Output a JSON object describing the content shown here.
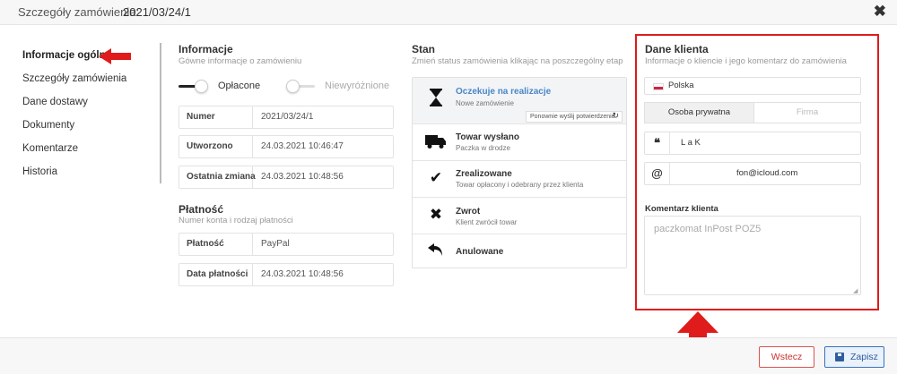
{
  "header": {
    "label": "Szczegóły zamówienia:",
    "order_id": "2021/03/24/1",
    "close_icon": "close-icon"
  },
  "nav": {
    "items": [
      {
        "label": "Informacje ogólne",
        "active": true
      },
      {
        "label": "Szczegóły zamówienia"
      },
      {
        "label": "Dane dostawy"
      },
      {
        "label": "Dokumenty"
      },
      {
        "label": "Komentarze"
      },
      {
        "label": "Historia"
      }
    ]
  },
  "info": {
    "title": "Informacje",
    "subtitle": "Gówne informacje o zamówieniu",
    "toggle_paid": {
      "label": "Opłacone",
      "on": true
    },
    "toggle_featured": {
      "label": "Niewyróżnione",
      "on": false
    },
    "fields": [
      {
        "label": "Numer",
        "value": "2021/03/24/1"
      },
      {
        "label": "Utworzono",
        "value": "24.03.2021 10:46:47"
      },
      {
        "label": "Ostatnia zmiana",
        "value": "24.03.2021 10:48:56"
      }
    ]
  },
  "payment": {
    "title": "Płatność",
    "subtitle": "Numer konta i rodzaj płatności",
    "fields": [
      {
        "label": "Płatność",
        "value": "PayPal"
      },
      {
        "label": "Data płatności",
        "value": "24.03.2021 10:48:56"
      }
    ]
  },
  "status": {
    "title": "Stan",
    "subtitle": "Zmień status zamówienia klikając na poszczególny etap",
    "resend_label": "Ponownie wyślij potwierdzenie",
    "items": [
      {
        "title": "Oczekuje na realizacje",
        "sub": "Nowe zamówienie",
        "icon": "hourglass-icon",
        "active": true
      },
      {
        "title": "Towar wysłano",
        "sub": "Paczka w drodze",
        "icon": "truck-icon"
      },
      {
        "title": "Zrealizowane",
        "sub": "Towar opłacony i odebrany przez klienta",
        "icon": "check-icon"
      },
      {
        "title": "Zwrot",
        "sub": "Klient zwrócił towar",
        "icon": "x-icon"
      },
      {
        "title": "Anulowane",
        "sub": "",
        "icon": "undo-icon"
      }
    ]
  },
  "client": {
    "title": "Dane klienta",
    "subtitle": "Informacje o kliencie i jego komentarz do zamówienia",
    "country": "Polska",
    "type_options": [
      "Osoba prywatna",
      "Firma"
    ],
    "type_selected": "Osoba prywatna",
    "name": "L     a K",
    "email": "fon@icloud.com",
    "comment_label": "Komentarz klienta",
    "comment": "paczkomat InPost POZ5",
    "highlight_color": "#e01b1b"
  },
  "footer": {
    "back_label": "Wstecz",
    "save_label": "Zapisz"
  },
  "colors": {
    "accent": "#4b86c7",
    "danger": "#d9534f",
    "primary": "#3b73b9"
  }
}
